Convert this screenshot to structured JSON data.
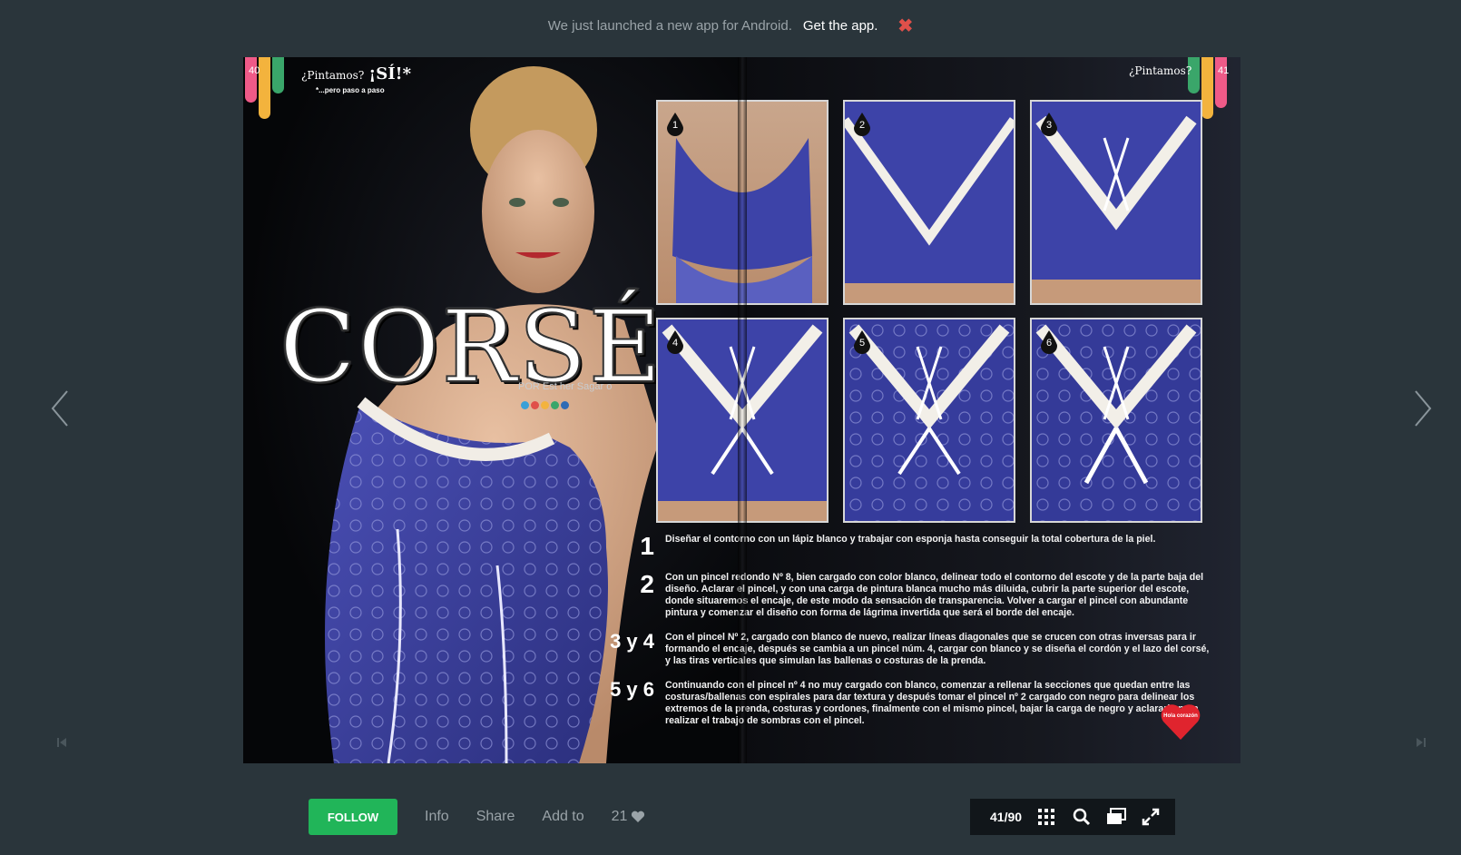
{
  "banner": {
    "message": "We just launched a new app for Android.",
    "cta": "Get the app.",
    "close_icon": "close-icon"
  },
  "navigation": {
    "prev_icon": "chevron-left-icon",
    "next_icon": "chevron-right-icon",
    "first_icon": "skip-first-icon",
    "last_icon": "skip-last-icon"
  },
  "spread": {
    "left_page_number": "40",
    "right_page_number": "41",
    "tag_question": "¿Pintamos?",
    "tag_answer": "¡SÍ!*",
    "tag_footnote": "*...pero paso a paso",
    "right_tag": "¿Pintamos?",
    "title": "CORSÉ",
    "byline": "POR Est her Sagar o",
    "drip_colors": [
      "#ef5a88",
      "#f3b33d",
      "#3aa66a"
    ],
    "byline_dot_colors": [
      "#3aa0d8",
      "#e0504a",
      "#f3b33d",
      "#3aa66a",
      "#2f6bb5"
    ],
    "step_numbers": [
      "1",
      "2",
      "3",
      "4",
      "5",
      "6"
    ],
    "instructions": [
      {
        "num": "1",
        "text": "Diseñar el contorno con un lápiz blanco y trabajar con esponja hasta conseguir la total cobertura de la piel."
      },
      {
        "num": "2",
        "text": "Con un pincel redondo Nº 8, bien cargado con color blanco, delinear todo el contorno del escote y de la parte baja del diseño. Aclarar el pincel, y con una carga de pintura blanca mucho más diluida, cubrir la parte superior del escote, donde situaremos el encaje, de este modo da sensación de transparencia. Volver a cargar el pincel con abundante pintura y comenzar el diseño con forma de lágrima invertida que será el borde del encaje."
      },
      {
        "num": "3 y 4",
        "text": "Con el pincel Nº 2, cargado con blanco de nuevo, realizar líneas diagonales que se crucen con otras inversas para ir formando el encaje, después se cambia a un pincel núm. 4, cargar con blanco y se diseña el cordón y el lazo del corsé, y las tiras verticales que simulan las ballenas o costuras de la prenda."
      },
      {
        "num": "5 y 6",
        "text": "Continuando con el pincel nº 4 no muy cargado con blanco, comenzar a rellenar la secciones que quedan entre las costuras/ballenas  con espirales para dar textura y después tomar el pincel nº 2 cargado con negro para delinear los extremos de la prenda, costuras y cordones, finalmente con el mismo pincel, bajar la carga de negro y aclararla para realizar el trabajo de sombras con el pincel."
      }
    ],
    "heart_label": "Hola corazón"
  },
  "footer": {
    "follow_label": "FOLLOW",
    "info_label": "Info",
    "share_label": "Share",
    "add_label": "Add to",
    "likes_count": "21",
    "heart_icon": "heart-icon"
  },
  "viewer": {
    "page_indicator": "41/90",
    "grid_icon": "grid-icon",
    "search_icon": "search-icon",
    "pages_icon": "pages-icon",
    "fullscreen_icon": "fullscreen-icon"
  },
  "colors": {
    "background": "#2a353b",
    "follow_green": "#21b559",
    "close_red": "#e0504a",
    "corset_blue": "#3a3f9e"
  }
}
